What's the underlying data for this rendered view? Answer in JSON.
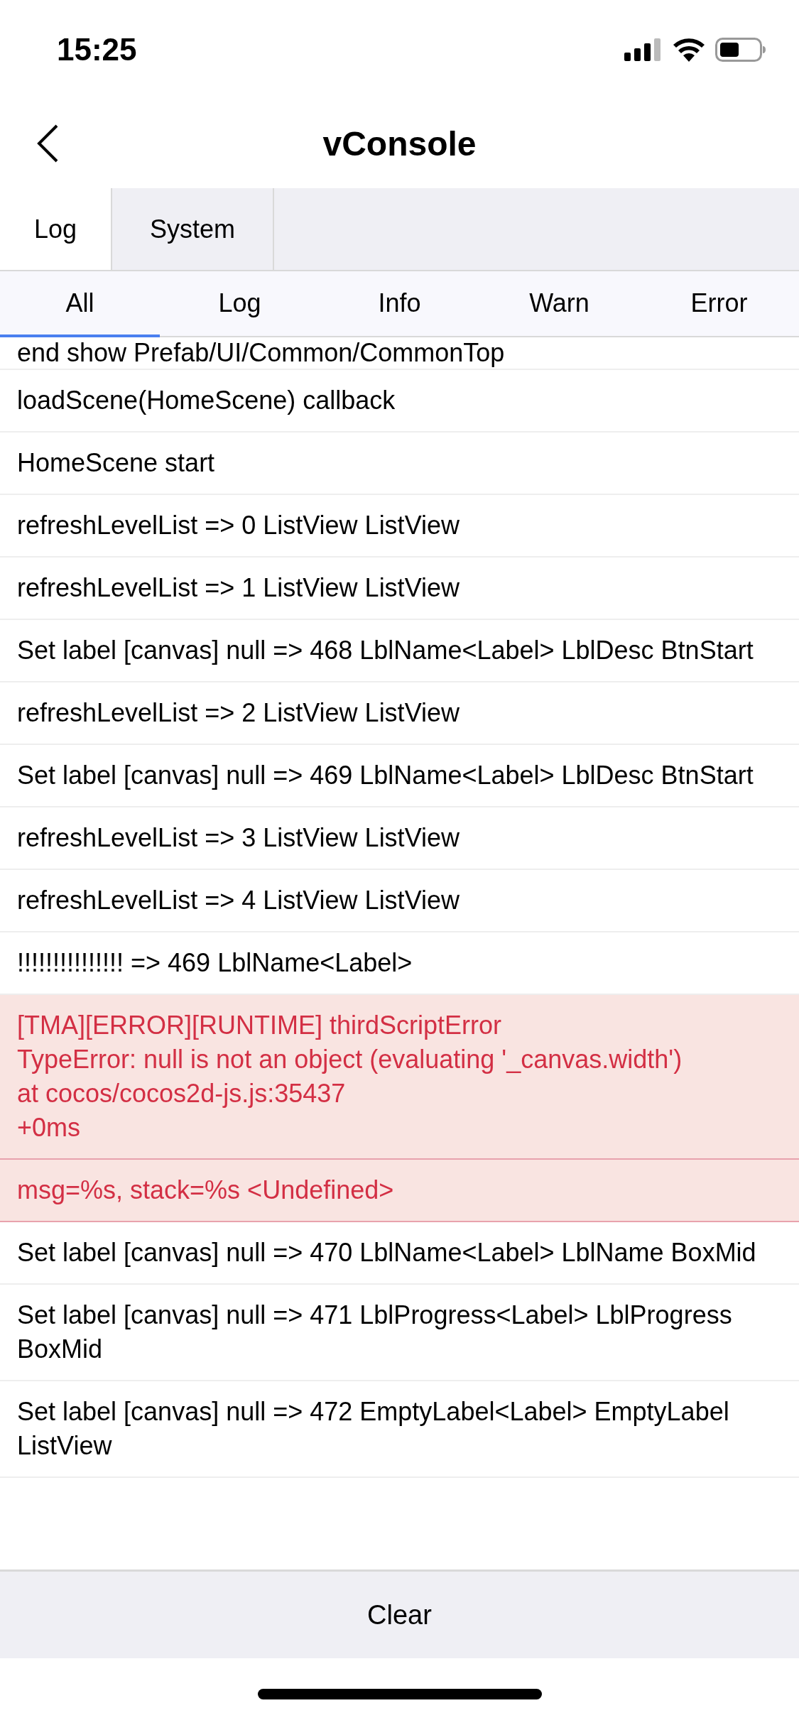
{
  "status_bar": {
    "time": "15:25"
  },
  "header": {
    "title": "vConsole"
  },
  "tabs": [
    {
      "label": "Log",
      "selected": true
    },
    {
      "label": "System",
      "selected": false
    }
  ],
  "filters": [
    {
      "label": "All",
      "selected": true
    },
    {
      "label": "Log",
      "selected": false
    },
    {
      "label": "Info",
      "selected": false
    },
    {
      "label": "Warn",
      "selected": false
    },
    {
      "label": "Error",
      "selected": false
    }
  ],
  "logs": [
    {
      "kind": "partial",
      "text": "end show Prefab/UI/Common/CommonTop"
    },
    {
      "kind": "log",
      "text": "loadScene(HomeScene) callback"
    },
    {
      "kind": "log",
      "text": "HomeScene start"
    },
    {
      "kind": "log",
      "text": "refreshLevelList => 0 ListView ListView"
    },
    {
      "kind": "log",
      "text": "refreshLevelList => 1 ListView ListView"
    },
    {
      "kind": "log",
      "text": "Set label [canvas] null => 468 LblName<Label> LblDesc BtnStart"
    },
    {
      "kind": "log",
      "text": "refreshLevelList => 2 ListView ListView"
    },
    {
      "kind": "log",
      "text": "Set label [canvas] null => 469 LblName<Label> LblDesc BtnStart"
    },
    {
      "kind": "log",
      "text": "refreshLevelList => 3 ListView ListView"
    },
    {
      "kind": "log",
      "text": "refreshLevelList => 4 ListView ListView"
    },
    {
      "kind": "log",
      "text": "!!!!!!!!!!!!!!! => 469 LblName<Label>"
    },
    {
      "kind": "error",
      "text": "[TMA][ERROR][RUNTIME] thirdScriptError\nTypeError: null is not an object (evaluating '_canvas.width')\nat cocos/cocos2d-js.js:35437\n+0ms"
    },
    {
      "kind": "error",
      "text": "msg=%s, stack=%s <Undefined>"
    },
    {
      "kind": "log",
      "text": "Set label [canvas] null => 470 LblName<Label> LblName BoxMid"
    },
    {
      "kind": "log",
      "text": "Set label [canvas] null => 471 LblProgress<Label> LblProgress BoxMid"
    },
    {
      "kind": "log",
      "text": "Set label [canvas] null => 472 EmptyLabel<Label> EmptyLabel ListView"
    }
  ],
  "footer": {
    "button": "Clear"
  }
}
